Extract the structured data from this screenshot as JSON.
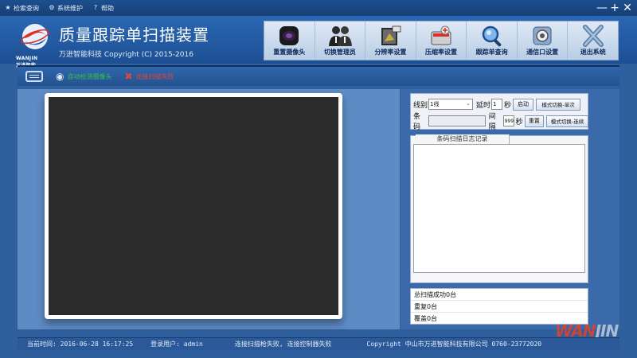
{
  "menu": {
    "items": [
      {
        "icon": "star-icon",
        "label": "检索查询"
      },
      {
        "icon": "gear-icon",
        "label": "系统维护"
      },
      {
        "icon": "help-icon",
        "label": "帮助"
      }
    ],
    "minimize": "—",
    "maximize": "+",
    "close": "✕"
  },
  "header": {
    "logo_text": "WANJIN",
    "logo_sub": "万进智能",
    "title": "质量跟踪单扫描装置",
    "subtitle": "万进智能科技 Copyright (C) 2015-2016"
  },
  "toolbar": {
    "buttons": [
      {
        "icon": "camera-icon",
        "label": "重置摄像头"
      },
      {
        "icon": "users-icon",
        "label": "切换管理员"
      },
      {
        "icon": "resolution-icon",
        "label": "分辨率设置"
      },
      {
        "icon": "compression-icon",
        "label": "压缩率设置"
      },
      {
        "icon": "search-icon",
        "label": "跟踪单查询"
      },
      {
        "icon": "settings-icon",
        "label": "通信口设置"
      },
      {
        "icon": "exit-icon",
        "label": "退出系统"
      }
    ]
  },
  "subbar": {
    "status_ok": "自动检测摄像头",
    "status_err": "连接扫描失败"
  },
  "controls": {
    "line_label": "线别",
    "line_value": "1线",
    "delay_label": "延时",
    "delay_value": "1",
    "delay_unit": "秒",
    "start_button": "启动",
    "mode_single": "模式切换-单次",
    "barcode_label": "条码",
    "barcode_value": "",
    "interval_label": "间隔",
    "interval_value": "999",
    "interval_unit": "秒",
    "reset_button": "重置",
    "mode_continuous": "模式切换-连续"
  },
  "log": {
    "title": "条码扫描日志记录"
  },
  "stats": {
    "total": "总扫描成功0台",
    "repeat": "重复0台",
    "cover": "覆盖0台"
  },
  "statusbar": {
    "time": "当前时间: 2016-06-28 16:17:25",
    "user": "登录用户: admin",
    "message": "连接扫描枪失败, 连接控制器失败",
    "copyright": "Copyright 中山市万进智能科技有限公司 0760-23772020"
  },
  "watermark": {
    "text_red": "WAN",
    "text_gray": "JIN"
  }
}
